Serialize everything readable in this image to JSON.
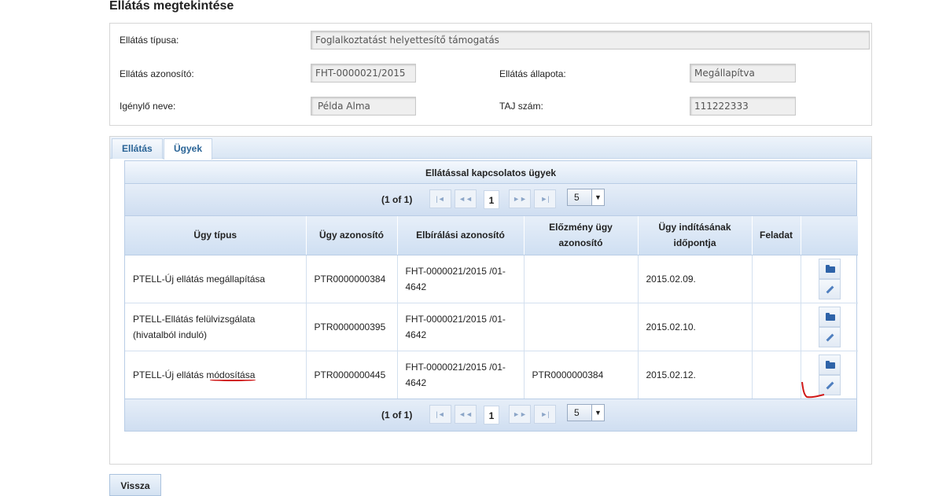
{
  "page": {
    "title": "Ellátás megtekintése"
  },
  "info": {
    "type_label": "Ellátás típusa:",
    "type_value": "Foglalkoztatást helyettesítő támogatás",
    "id_label": "Ellátás azonosító:",
    "id_value": "FHT-0000021/2015",
    "status_label": "Ellátás állapota:",
    "status_value": "Megállapítva",
    "applicant_label": "Igénylő neve:",
    "applicant_value": "Példa Alma",
    "taj_label": "TAJ szám:",
    "taj_value": "111222333"
  },
  "tabs": [
    {
      "label": "Ellátás",
      "active": false
    },
    {
      "label": "Ügyek",
      "active": true
    }
  ],
  "grid": {
    "caption": "Ellátással kapcsolatos ügyek",
    "pager_text": "(1 of 1)",
    "current_page": "1",
    "rows_per_page": "5",
    "pager_icons": {
      "first": "|◄",
      "prev": "◄◄",
      "next": "►►",
      "last": "►|"
    },
    "columns": [
      "Ügy típus",
      "Ügy azonosító",
      "Elbírálási azonosító",
      "Előzmény ügy azonosító",
      "Ügy indításának időpontja",
      "Feladat",
      ""
    ],
    "rows": [
      {
        "type": "PTELL-Új ellátás megállapítása",
        "id": "PTR0000000384",
        "decision_id": "FHT-0000021/2015 /01-4642",
        "prev_id": "",
        "start_date": "2015.02.09.",
        "task": ""
      },
      {
        "type": "PTELL-Ellátás felülvizsgálata (hivatalból induló)",
        "id": "PTR0000000395",
        "decision_id": "FHT-0000021/2015 /01-4642",
        "prev_id": "",
        "start_date": "2015.02.10.",
        "task": ""
      },
      {
        "type": "PTELL-Új ellátás módosítása",
        "id": "PTR0000000445",
        "decision_id": "FHT-0000021/2015 /01-4642",
        "prev_id": "PTR0000000384",
        "start_date": "2015.02.12.",
        "task": ""
      }
    ]
  },
  "back_button": "Vissza",
  "colors": {
    "accent": "#2a6496",
    "header_bg": "#cfdff2",
    "annotation": "#d01818"
  }
}
